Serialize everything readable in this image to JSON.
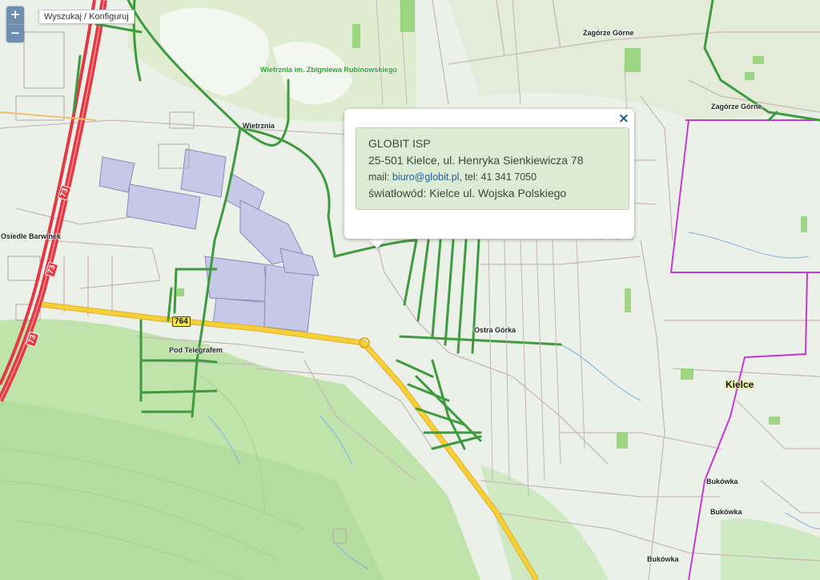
{
  "controls": {
    "zoom_in": "+",
    "zoom_out": "−",
    "search_button": "Wyszukaj / Konfiguruj"
  },
  "labels": {
    "park": "Wietrznia im. Zbigniewa Rubinowskiego",
    "wietrznia": "Wietrznia",
    "zagorze_1": "Zagórze Górne",
    "zagorze_2": "Zagórze Górne",
    "osiedle_barwinek": "Osiedle Barwinek",
    "ostra_gorka": "Ostra Górka",
    "pod_telegrafem": "Pod Telegrafem",
    "kielce": "Kielce",
    "bukowka_1": "Bukówka",
    "bukowka_2": "Bukówka",
    "bukowka_3": "Bukówka"
  },
  "road_shields": {
    "r73_a": "73",
    "r73_b": "73",
    "r73_c": "73",
    "r764": "764"
  },
  "popup": {
    "close": "×",
    "company": "GLOBIT ISP",
    "address": "25-501 Kielce, ul. Henryka Sienkiewicza 78",
    "mail_label": "mail: ",
    "email": "biuro@globit.pl",
    "tel_label": ", tel: ",
    "phone": "41 341 7050",
    "fiber": "światłowód: Kielce ul. Wojska Polskiego"
  },
  "colors": {
    "map_bg": "#ebf0e8",
    "forest": "#b8dfa6",
    "buildings": "#c6c8e8",
    "fiber_lines": "#3f9a3f",
    "main_road": "#f3c62a",
    "expressway": "#e23a45",
    "boundary": "#c23ad0",
    "popup_box": "#dcebd3"
  }
}
